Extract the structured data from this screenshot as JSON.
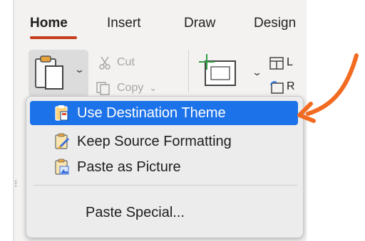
{
  "tabs": [
    {
      "label": "Home",
      "active": true
    },
    {
      "label": "Insert",
      "active": false
    },
    {
      "label": "Draw",
      "active": false
    },
    {
      "label": "Design",
      "active": false
    }
  ],
  "ribbon": {
    "cut_label": "Cut",
    "copy_label": "Copy",
    "copy_chevron": "⌄",
    "layout_partial": "L",
    "reset_partial": "R"
  },
  "paste_menu": {
    "items": [
      {
        "label": "Use Destination Theme",
        "icon": "clipboard-theme-icon",
        "selected": true
      },
      {
        "label": "Keep Source Formatting",
        "icon": "clipboard-brush-icon",
        "selected": false
      },
      {
        "label": "Paste as Picture",
        "icon": "clipboard-picture-icon",
        "selected": false
      }
    ],
    "special_label": "Paste Special..."
  },
  "colors": {
    "accent_underline": "#c43e1c",
    "selection": "#1c72e8",
    "annotation_arrow": "#f26b21"
  }
}
